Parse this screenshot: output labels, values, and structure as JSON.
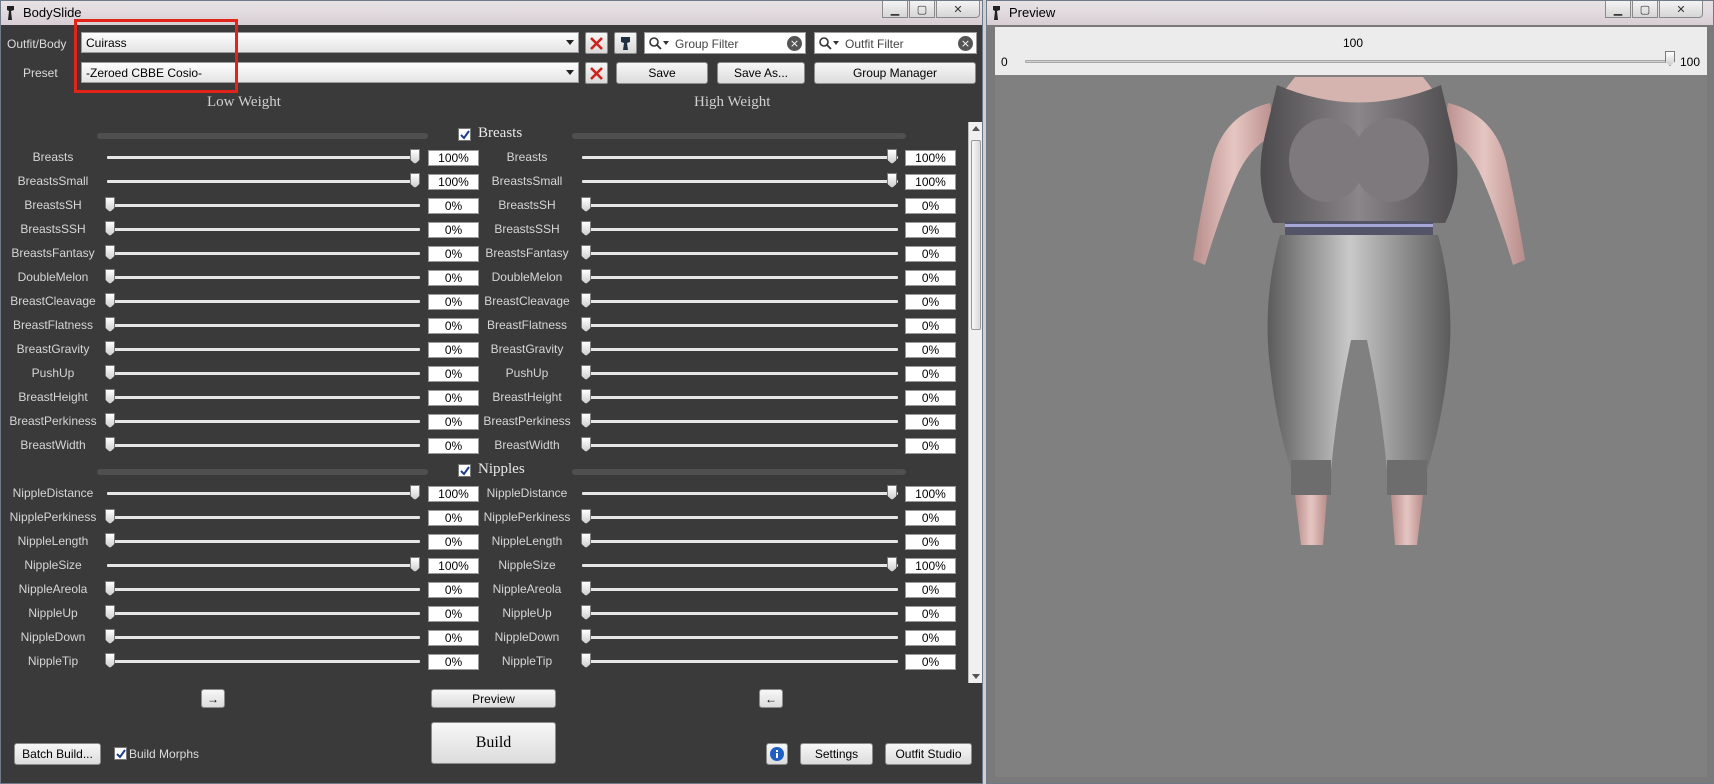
{
  "bodyslide": {
    "title": "BodySlide",
    "outfit_label": "Outfit/Body",
    "outfit_value": "Cuirass",
    "preset_label": "Preset",
    "preset_value": "-Zeroed CBBE Cosio-",
    "group_filter_placeholder": "Group Filter",
    "outfit_filter_placeholder": "Outfit Filter",
    "save_label": "Save",
    "save_as_label": "Save As...",
    "group_manager_label": "Group Manager",
    "low_weight_label": "Low Weight",
    "high_weight_label": "High Weight",
    "preview_label": "Preview",
    "build_label": "Build",
    "batch_build_label": "Batch Build...",
    "build_morphs_label": "Build Morphs",
    "settings_label": "Settings",
    "outfit_studio_label": "Outfit Studio",
    "arrow_right": "→",
    "arrow_left": "←",
    "groups": [
      {
        "name": "Breasts",
        "checked": true,
        "sliders": [
          {
            "name": "Breasts",
            "low": "100%",
            "high": "100%"
          },
          {
            "name": "BreastsSmall",
            "low": "100%",
            "high": "100%"
          },
          {
            "name": "BreastsSH",
            "low": "0%",
            "high": "0%"
          },
          {
            "name": "BreastsSSH",
            "low": "0%",
            "high": "0%"
          },
          {
            "name": "BreastsFantasy",
            "low": "0%",
            "high": "0%"
          },
          {
            "name": "DoubleMelon",
            "low": "0%",
            "high": "0%"
          },
          {
            "name": "BreastCleavage",
            "low": "0%",
            "high": "0%"
          },
          {
            "name": "BreastFlatness",
            "low": "0%",
            "high": "0%"
          },
          {
            "name": "BreastGravity",
            "low": "0%",
            "high": "0%"
          },
          {
            "name": "PushUp",
            "low": "0%",
            "high": "0%"
          },
          {
            "name": "BreastHeight",
            "low": "0%",
            "high": "0%"
          },
          {
            "name": "BreastPerkiness",
            "low": "0%",
            "high": "0%"
          },
          {
            "name": "BreastWidth",
            "low": "0%",
            "high": "0%"
          }
        ]
      },
      {
        "name": "Nipples",
        "checked": true,
        "sliders": [
          {
            "name": "NippleDistance",
            "low": "100%",
            "high": "100%"
          },
          {
            "name": "NipplePerkiness",
            "low": "0%",
            "high": "0%"
          },
          {
            "name": "NippleLength",
            "low": "0%",
            "high": "0%"
          },
          {
            "name": "NippleSize",
            "low": "100%",
            "high": "100%"
          },
          {
            "name": "NippleAreola",
            "low": "0%",
            "high": "0%"
          },
          {
            "name": "NippleUp",
            "low": "0%",
            "high": "0%"
          },
          {
            "name": "NippleDown",
            "low": "0%",
            "high": "0%"
          },
          {
            "name": "NippleTip",
            "low": "0%",
            "high": "0%"
          }
        ]
      }
    ]
  },
  "preview": {
    "title": "Preview",
    "slider_value": "100",
    "slider_min": "0",
    "slider_max": "100",
    "slider_level": 1.0
  }
}
